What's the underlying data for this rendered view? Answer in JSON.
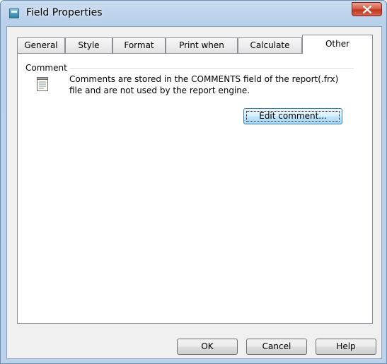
{
  "window": {
    "title": "Field Properties",
    "close_label": "X"
  },
  "tabs": [
    {
      "label": "General",
      "active": false
    },
    {
      "label": "Style",
      "active": false
    },
    {
      "label": "Format",
      "active": false
    },
    {
      "label": "Print when",
      "active": false
    },
    {
      "label": "Calculate",
      "active": false
    },
    {
      "label": "Other",
      "active": true
    }
  ],
  "comment_group": {
    "label": "Comment",
    "icon": "notepad-icon",
    "text_line1": "Comments are stored in the COMMENTS field of the report(.frx)",
    "text_line2": "file and are not used by the report engine.",
    "edit_button": "Edit comment..."
  },
  "footer": {
    "ok": "OK",
    "cancel": "Cancel",
    "help": "Help"
  },
  "colors": {
    "close_button": "#c0361f",
    "focus_button": "#bee6fd"
  }
}
